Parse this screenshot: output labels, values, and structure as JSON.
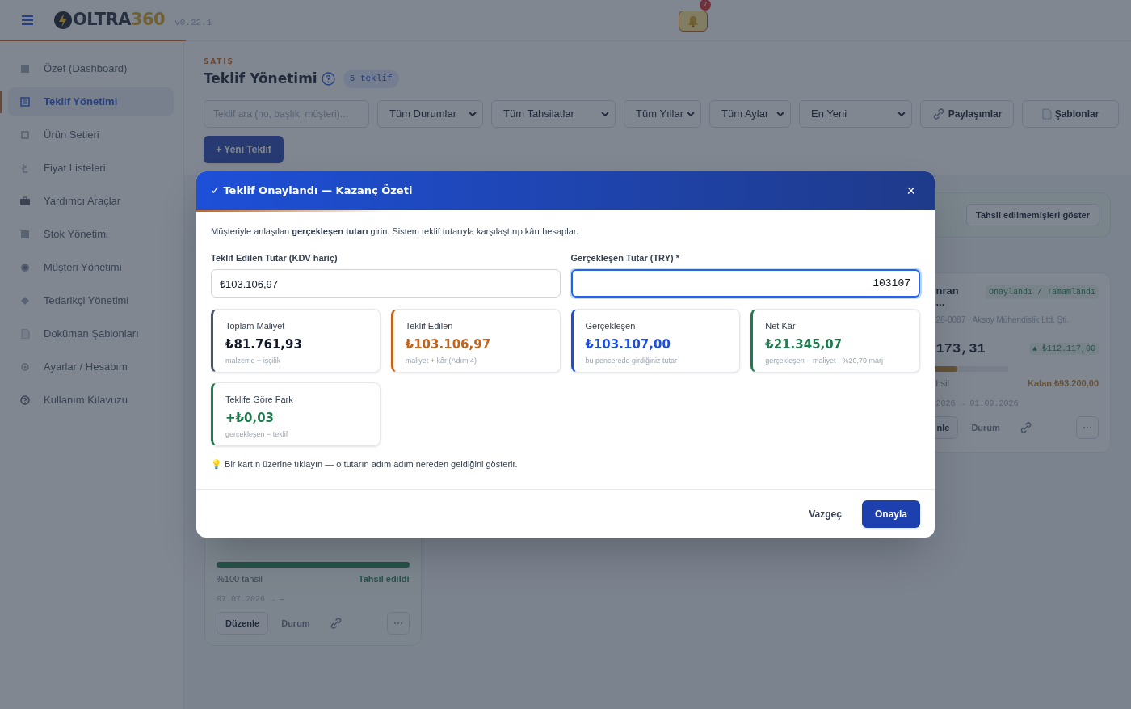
{
  "header": {
    "logo_word": "OLTRA",
    "logo_number": "360",
    "version": "v0.22.1",
    "notification_count": "7"
  },
  "sidebar": {
    "items": [
      {
        "label": "Özet (Dashboard)",
        "selected": false
      },
      {
        "label": "Teklif Yönetimi",
        "selected": true
      },
      {
        "label": "Ürün Setleri",
        "selected": false
      },
      {
        "label": "Fiyat Listeleri",
        "selected": false
      },
      {
        "label": "Yardımcı Araçlar",
        "selected": false
      },
      {
        "label": "Stok Yönetimi",
        "selected": false
      },
      {
        "label": "Müşteri Yönetimi",
        "selected": false
      },
      {
        "label": "Tedarikçi Yönetimi",
        "selected": false
      },
      {
        "label": "Doküman Şablonları",
        "selected": false
      },
      {
        "label": "Ayarlar / Hesabım",
        "selected": false
      },
      {
        "label": "Kullanım Kılavuzu",
        "selected": false
      }
    ]
  },
  "page": {
    "section": "SATIŞ",
    "title": "Teklif Yönetimi",
    "count": "5 teklif",
    "search": {
      "placeholder": "Teklif ara (no, başlık, müşteri)..."
    },
    "filters": [
      "Tüm Durumlar",
      "Tüm Tahsilatlar",
      "Tüm Yıllar",
      "Tüm Aylar",
      "En Yeni"
    ],
    "buttons": [
      "Paylaşımlar",
      "Şablonlar"
    ],
    "new_button": "+ Yeni Teklif",
    "banner_button": "Tahsil edilmemişleri göster"
  },
  "cards": [
    {
      "title": "nran",
      "title_more": "...",
      "ref": "26-0087 · Aksoy Mühendislik Ltd. Şti.",
      "status": "Onaylandı / Tamamlandı",
      "amount": "173,31",
      "delta": "▲ ₺112.117,00",
      "level": 0.55,
      "kind": "partial",
      "collected": "hsil",
      "remaining": "Kalan ₺93.200,00",
      "dates": "2026 → 01.09.2026",
      "edit": "nle",
      "status_button": "Durum",
      "more": "⋯"
    },
    {
      "level": 1,
      "kind": "paid",
      "collected": "%100 tahsil",
      "remaining": "Tahsil edildi",
      "dates": "07.07.2026 → —",
      "edit": "Düzenle",
      "status_button": "Durum",
      "more": "⋯"
    }
  ],
  "modal": {
    "title": "✓ Teklif Onaylandı — Kazanç Özeti",
    "close": "×",
    "intro": "Müşteriyle anlaşılan **gerçekleşen tutarı** girin. Sistem teklif tutarıyla karşılaştırıp kârı hesaplar.",
    "offered_label": "Teklif Edilen Tutar (KDV hariç)",
    "offered_value": "₺103.106,97",
    "actual_label": "Gerçekleşen Tutar (TRY) *",
    "actual_value": "103107",
    "stats": [
      {
        "label": "Toplam Maliyet",
        "value": "₺81.761,93",
        "note": "malzeme + işçilik",
        "color": "#475569"
      },
      {
        "label": "Teklif Edilen",
        "value": "₺103.106,97",
        "note": "maliyet + kâr (Adım 4)",
        "color": "#c2641a"
      },
      {
        "label": "Gerçekleşen",
        "value": "₺103.107,00",
        "note": "bu pencerede girdiğiniz tutar",
        "color": "#1d4ed8"
      },
      {
        "label": "Net Kâr",
        "value": "₺21.345,07",
        "note": "gerçekleşen − maliyet · %20,70 marj",
        "color": "#1f7a4d"
      },
      {
        "label": "Teklife Göre Fark",
        "value": "+₺0,03",
        "note": "gerçekleşen − teklif",
        "color": "#1f7a4d"
      }
    ],
    "hint": "💡 Bir kartın üzerine tıklayın — o tutarın adım adım nereden geldiğini gösterir.",
    "cancel": "Vazgeç",
    "confirm": "Onayla"
  }
}
